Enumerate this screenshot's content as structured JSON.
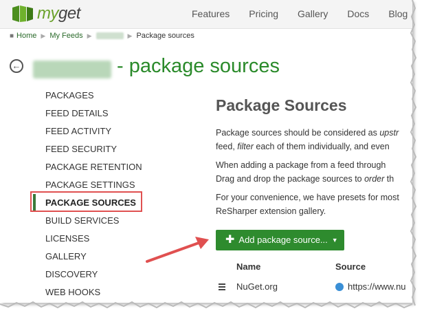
{
  "brand": {
    "prefix": "my",
    "name": "get"
  },
  "nav": [
    "Features",
    "Pricing",
    "Gallery",
    "Docs",
    "Blog"
  ],
  "breadcrumb": {
    "home": "Home",
    "feeds": "My Feeds",
    "current": "Package sources"
  },
  "page_title": "- package sources",
  "menu": [
    "PACKAGES",
    "FEED DETAILS",
    "FEED ACTIVITY",
    "FEED SECURITY",
    "PACKAGE RETENTION",
    "PACKAGE SETTINGS",
    "PACKAGE SOURCES",
    "BUILD SERVICES",
    "LICENSES",
    "GALLERY",
    "DISCOVERY",
    "WEB HOOKS"
  ],
  "active_menu": "PACKAGE SOURCES",
  "content": {
    "heading": "Package Sources",
    "p1_a": "Package sources should be considered as ",
    "p1_em": "upstr",
    "p1_b": "feed, ",
    "p1_b_em": "filter",
    "p1_c": " each of them individually, and even ",
    "p2_a": "When adding a package from a feed through ",
    "p2_b": "Drag and drop the package sources to ",
    "p2_b_em": "order",
    "p2_c": " th",
    "p3_a": "For your convenience, we have presets for most",
    "p3_b": "ReSharper extension gallery."
  },
  "add_button": "Add package source...",
  "table": {
    "col_name": "Name",
    "col_source": "Source",
    "rows": [
      {
        "name": "NuGet.org",
        "source": "https://www.nu"
      }
    ]
  },
  "colors": {
    "accent": "#2e8b2e",
    "title": "#2a8a2a",
    "highlight": "#e05050"
  }
}
